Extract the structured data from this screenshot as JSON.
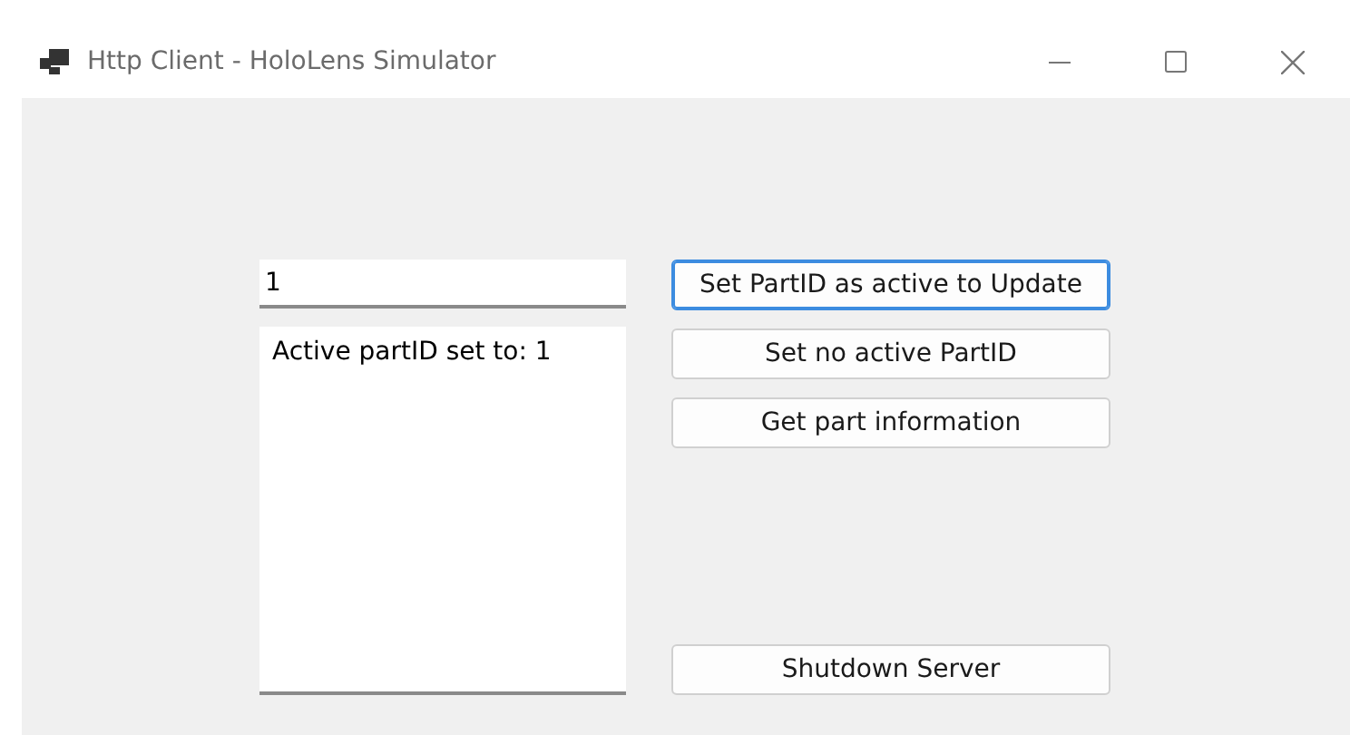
{
  "window": {
    "title": "Http Client - HoloLens Simulator"
  },
  "part_id_field": {
    "value": "1"
  },
  "log": {
    "text": "Active partID set to: 1"
  },
  "buttons": [
    {
      "label": "Set PartID as active to Update",
      "focused": true
    },
    {
      "label": "Set no active PartID",
      "focused": false
    },
    {
      "label": "Get part information",
      "focused": false
    },
    {
      "label": "Shutdown Server",
      "focused": false
    }
  ]
}
